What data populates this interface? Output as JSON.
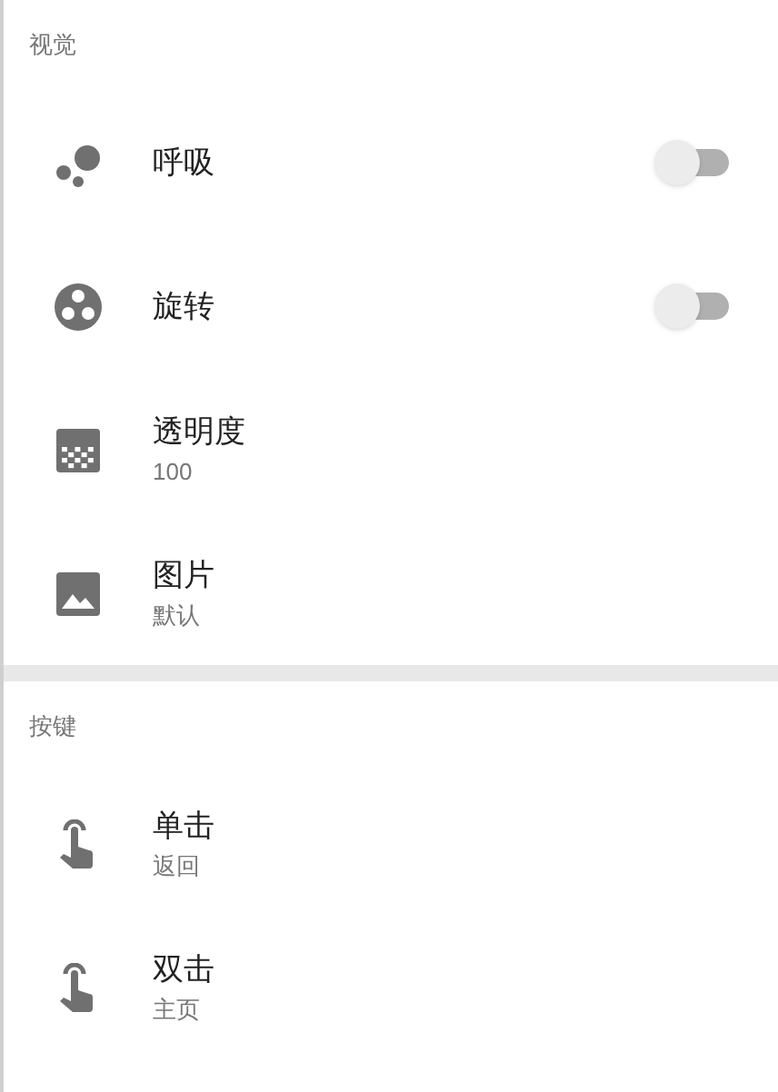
{
  "sections": [
    {
      "header": "视觉",
      "items": [
        {
          "kind": "switch",
          "title": "呼吸",
          "on": false
        },
        {
          "kind": "switch",
          "title": "旋转",
          "on": false
        },
        {
          "kind": "value",
          "title": "透明度",
          "summary": "100"
        },
        {
          "kind": "value",
          "title": "图片",
          "summary": "默认"
        }
      ]
    },
    {
      "header": "按键",
      "items": [
        {
          "kind": "value",
          "title": "单击",
          "summary": "返回"
        },
        {
          "kind": "value",
          "title": "双击",
          "summary": "主页"
        }
      ]
    }
  ]
}
